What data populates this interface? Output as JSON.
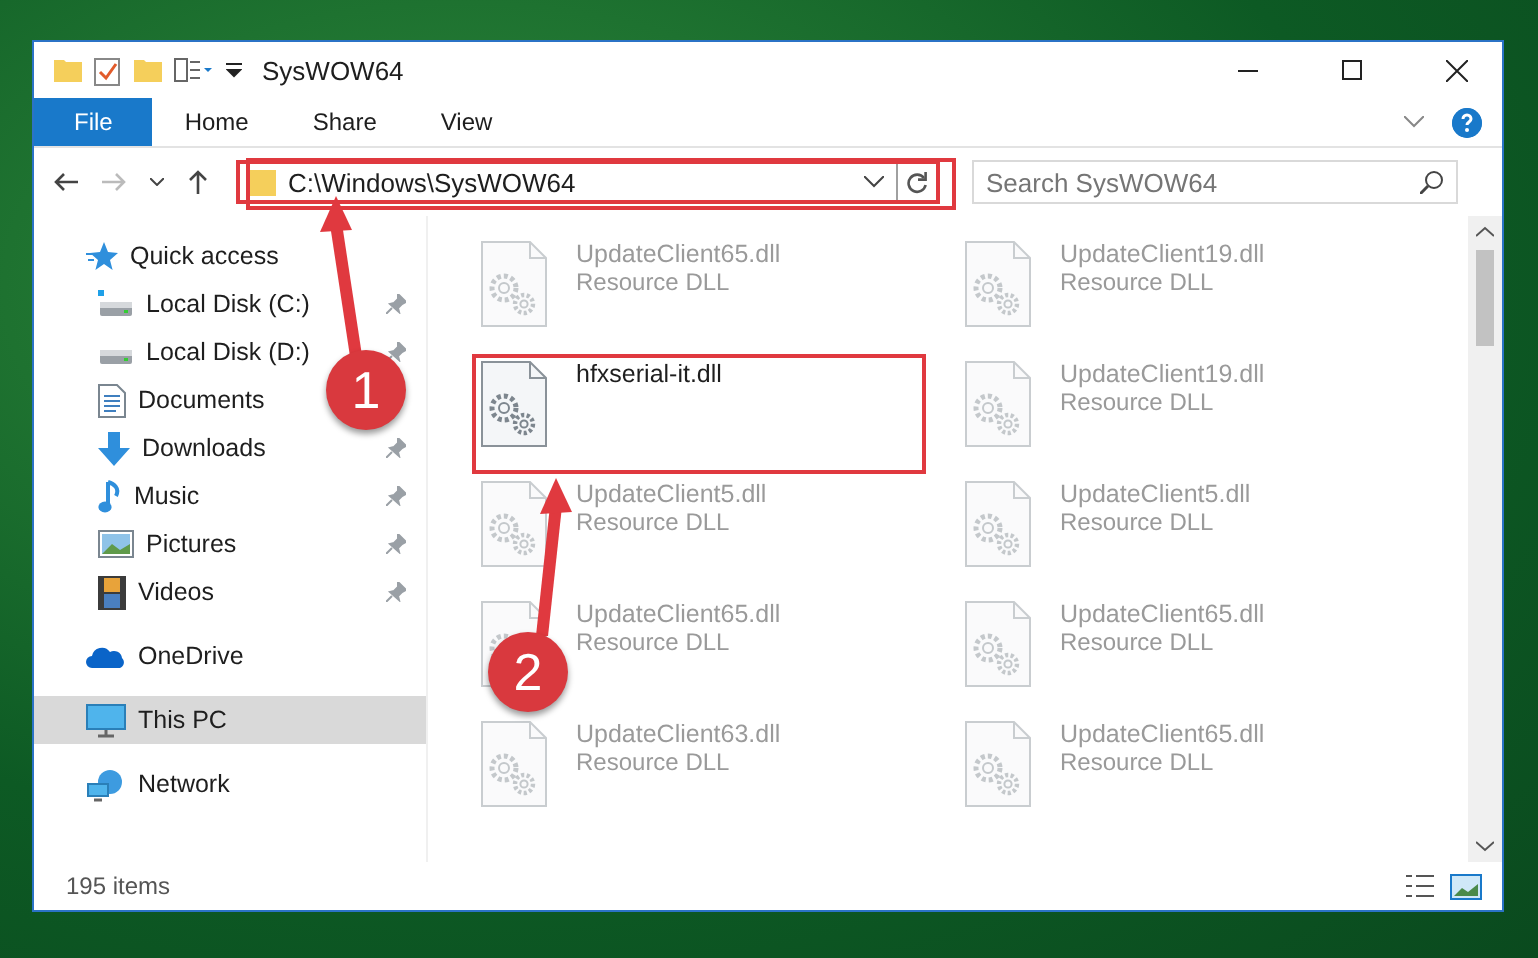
{
  "window": {
    "title": "SysWOW64"
  },
  "ribbon_tabs": [
    {
      "label": "File",
      "selected": true
    },
    {
      "label": "Home",
      "selected": false
    },
    {
      "label": "Share",
      "selected": false
    },
    {
      "label": "View",
      "selected": false
    }
  ],
  "address": {
    "value": "C:\\Windows\\SysWOW64"
  },
  "search": {
    "placeholder": "Search SysWOW64"
  },
  "sidebar": {
    "items": [
      {
        "label": "Quick access",
        "selected": false,
        "children": [
          {
            "label": "Local Disk (C:)",
            "pinned": true
          },
          {
            "label": "Local Disk (D:)",
            "pinned": true
          },
          {
            "label": "Documents",
            "pinned": false
          },
          {
            "label": "Downloads",
            "pinned": true
          },
          {
            "label": "Music",
            "pinned": true
          },
          {
            "label": "Pictures",
            "pinned": true
          },
          {
            "label": "Videos",
            "pinned": true
          }
        ]
      },
      {
        "label": "OneDrive",
        "selected": false
      },
      {
        "label": "This PC",
        "selected": true
      },
      {
        "label": "Network",
        "selected": false
      }
    ]
  },
  "files": [
    {
      "name": "UpdateClient65.dll",
      "type": "Resource DLL",
      "dimmed": true
    },
    {
      "name": "UpdateClient19.dll",
      "type": "Resource DLL",
      "dimmed": true
    },
    {
      "name": "hfxserial-it.dll",
      "dimmed": false
    },
    {
      "name": "UpdateClient19.dll",
      "type": "Resource DLL",
      "dimmed": true
    },
    {
      "name": "UpdateClient5.dll",
      "type": "Resource DLL",
      "dimmed": true
    },
    {
      "name": "UpdateClient5.dll",
      "type": "Resource DLL",
      "dimmed": true
    },
    {
      "name": "UpdateClient65.dll",
      "type": "Resource DLL",
      "dimmed": true
    },
    {
      "name": "UpdateClient65.dll",
      "type": "Resource DLL",
      "dimmed": true
    },
    {
      "name": "UpdateClient63.dll",
      "type": "Resource DLL",
      "dimmed": true
    },
    {
      "name": "UpdateClient65.dll",
      "type": "Resource DLL",
      "dimmed": true
    }
  ],
  "status_bar": {
    "count": "195 items"
  },
  "annotations": [
    {
      "label": "1"
    },
    {
      "label": "2"
    }
  ]
}
